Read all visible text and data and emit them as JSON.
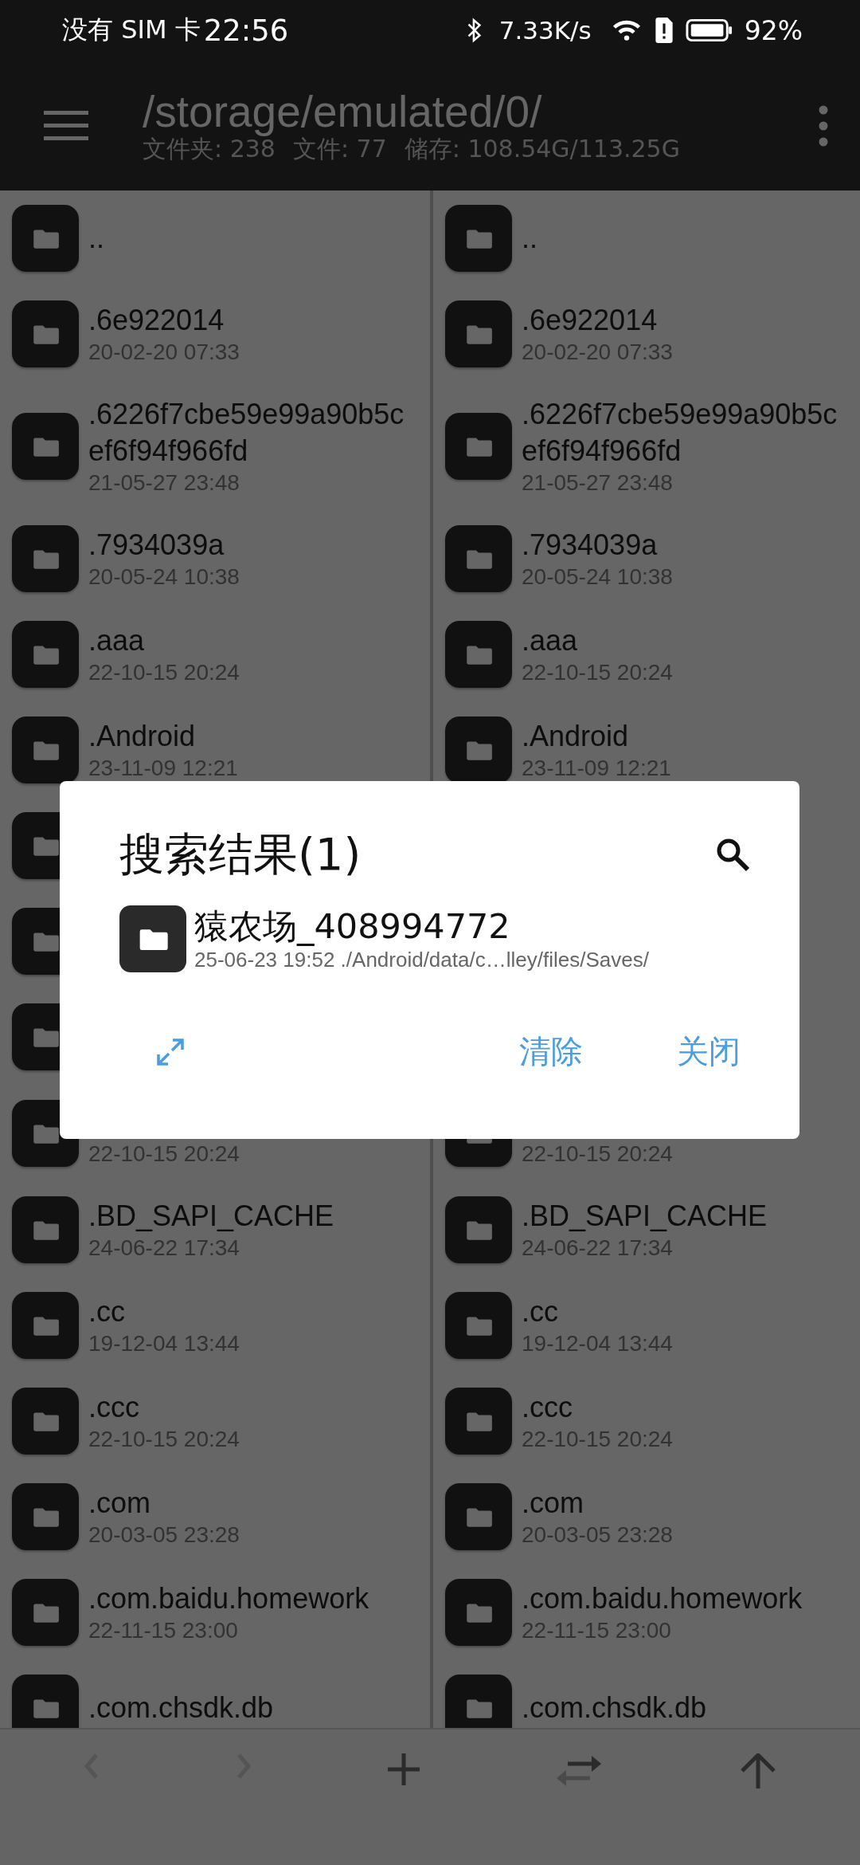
{
  "status_bar": {
    "carrier": "没有 SIM 卡",
    "time": "22:56",
    "net_speed": "7.33K/s",
    "battery": "92%"
  },
  "header": {
    "path": "/storage/emulated/0/",
    "stats": [
      "文件夹: 238",
      "文件: 77",
      "储存: 108.54G/113.25G"
    ]
  },
  "panels": [
    {
      "rows": [
        {
          "kind": "folder",
          "name": ".."
        },
        {
          "kind": "folder",
          "name": ".6e922014",
          "date": "20-02-20 07:33"
        },
        {
          "kind": "folder",
          "name": ".6226f7cbe59e99a90b5cef6f94f966fd",
          "date": "21-05-27 23:48"
        },
        {
          "kind": "folder",
          "name": ".7934039a",
          "date": "20-05-24 10:38"
        },
        {
          "kind": "folder",
          "name": ".aaa",
          "date": "22-10-15 20:24"
        },
        {
          "kind": "folder",
          "name": ".Android",
          "date": "23-11-09 12:21"
        },
        {
          "kind": "folder"
        },
        {
          "kind": "folder"
        },
        {
          "kind": "folder"
        },
        {
          "kind": "folder",
          "date": "22-10-15 20:24"
        },
        {
          "kind": "folder",
          "name": ".BD_SAPI_CACHE",
          "date": "24-06-22 17:34"
        },
        {
          "kind": "folder",
          "name": ".cc",
          "date": "19-12-04 13:44"
        },
        {
          "kind": "folder",
          "name": ".ccc",
          "date": "22-10-15 20:24"
        },
        {
          "kind": "folder",
          "name": ".com",
          "date": "20-03-05 23:28"
        },
        {
          "kind": "folder",
          "name": ".com.baidu.homework",
          "date": "22-11-15 23:00"
        },
        {
          "kind": "folder",
          "name": ".com.chsdk.db"
        }
      ]
    },
    {
      "rows": [
        {
          "kind": "folder",
          "name": ".."
        },
        {
          "kind": "folder",
          "name": ".6e922014",
          "date": "20-02-20 07:33"
        },
        {
          "kind": "folder",
          "name": ".6226f7cbe59e99a90b5cef6f94f966fd",
          "date": "21-05-27 23:48"
        },
        {
          "kind": "folder",
          "name": ".7934039a",
          "date": "20-05-24 10:38"
        },
        {
          "kind": "folder",
          "name": ".aaa",
          "date": "22-10-15 20:24"
        },
        {
          "kind": "folder",
          "name": ".Android",
          "date": "23-11-09 12:21"
        },
        {
          "kind": "covered"
        },
        {
          "kind": "covered"
        },
        {
          "kind": "covered"
        },
        {
          "kind": "folder",
          "date": "22-10-15 20:24"
        },
        {
          "kind": "folder",
          "name": ".BD_SAPI_CACHE",
          "date": "24-06-22 17:34"
        },
        {
          "kind": "folder",
          "name": ".cc",
          "date": "19-12-04 13:44"
        },
        {
          "kind": "folder",
          "name": ".ccc",
          "date": "22-10-15 20:24"
        },
        {
          "kind": "folder",
          "name": ".com",
          "date": "20-03-05 23:28"
        },
        {
          "kind": "folder",
          "name": ".com.baidu.homework",
          "date": "22-11-15 23:00"
        },
        {
          "kind": "folder",
          "name": ".com.chsdk.db"
        }
      ]
    }
  ],
  "bottom_bar": [
    {
      "kind": "back",
      "disabled": true
    },
    {
      "kind": "forward",
      "disabled": true
    },
    {
      "kind": "add",
      "disabled": false
    },
    {
      "kind": "swap",
      "disabled": false
    },
    {
      "kind": "up",
      "disabled": false
    }
  ],
  "dialog": {
    "title": "搜索结果(1)",
    "results": [
      {
        "kind": "folder",
        "name": "猿农场_408994772",
        "detail": "25-06-23 19:52 ./Android/data/c…lley/files/Saves/"
      }
    ],
    "buttons": [
      "清除",
      "关闭"
    ]
  }
}
